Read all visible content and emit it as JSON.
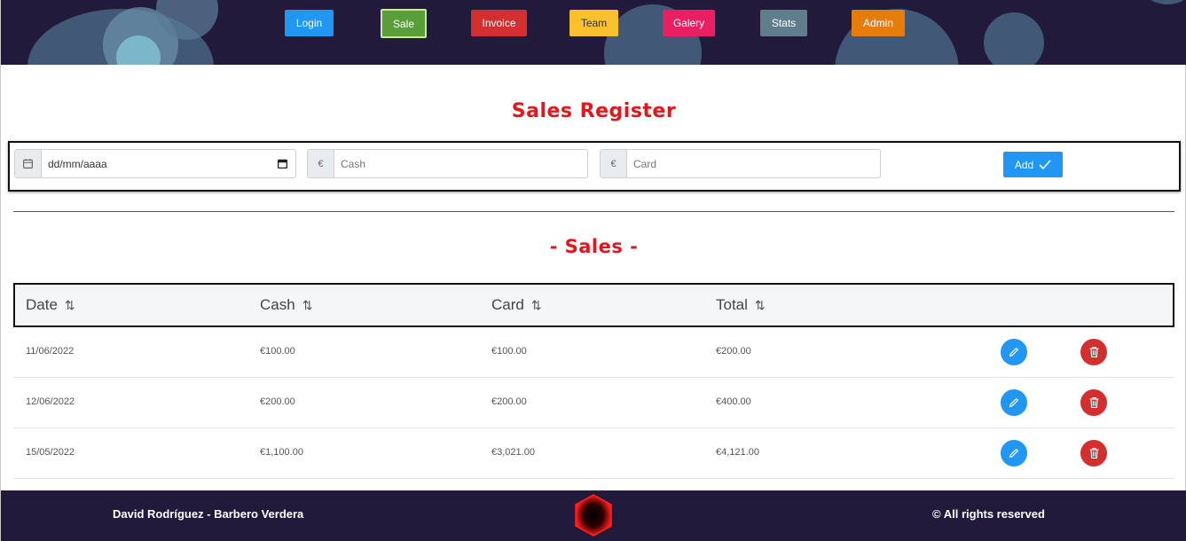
{
  "nav": {
    "items": [
      {
        "label": "Login",
        "color": "#2196f3",
        "active": false
      },
      {
        "label": "Sale",
        "color": "#5a9e3a",
        "active": true
      },
      {
        "label": "Invoice",
        "color": "#d32f2f",
        "active": false
      },
      {
        "label": "Team",
        "color": "#fbc02d",
        "active": false
      },
      {
        "label": "Galery",
        "color": "#e91e63",
        "active": false
      },
      {
        "label": "Stats",
        "color": "#607d8b",
        "active": false
      },
      {
        "label": "Admin",
        "color": "#e57c0b",
        "active": false
      }
    ]
  },
  "form": {
    "title": "Sales Register",
    "date_placeholder": "dd/mm/aaaa",
    "currency_symbol": "€",
    "cash_placeholder": "Cash",
    "card_placeholder": "Card",
    "add_label": "Add"
  },
  "table": {
    "title": "- Sales -",
    "headers": [
      "Date",
      "Cash",
      "Card",
      "Total"
    ],
    "rows": [
      {
        "date": "11/06/2022",
        "cash": "€100.00",
        "card": "€100.00",
        "total": "€200.00"
      },
      {
        "date": "12/06/2022",
        "cash": "€200.00",
        "card": "€200.00",
        "total": "€400.00"
      },
      {
        "date": "15/05/2022",
        "cash": "€1,100.00",
        "card": "€3,021.00",
        "total": "€4,121.00"
      }
    ]
  },
  "footer": {
    "author": "David Rodríguez - Barbero Verdera",
    "rights": "All rights reserved",
    "copyright_symbol": "©"
  },
  "colors": {
    "header_bg": "#221a3a",
    "title_red": "#e8141b",
    "accent_blue": "#2196f3",
    "danger_red": "#d32f2f"
  }
}
